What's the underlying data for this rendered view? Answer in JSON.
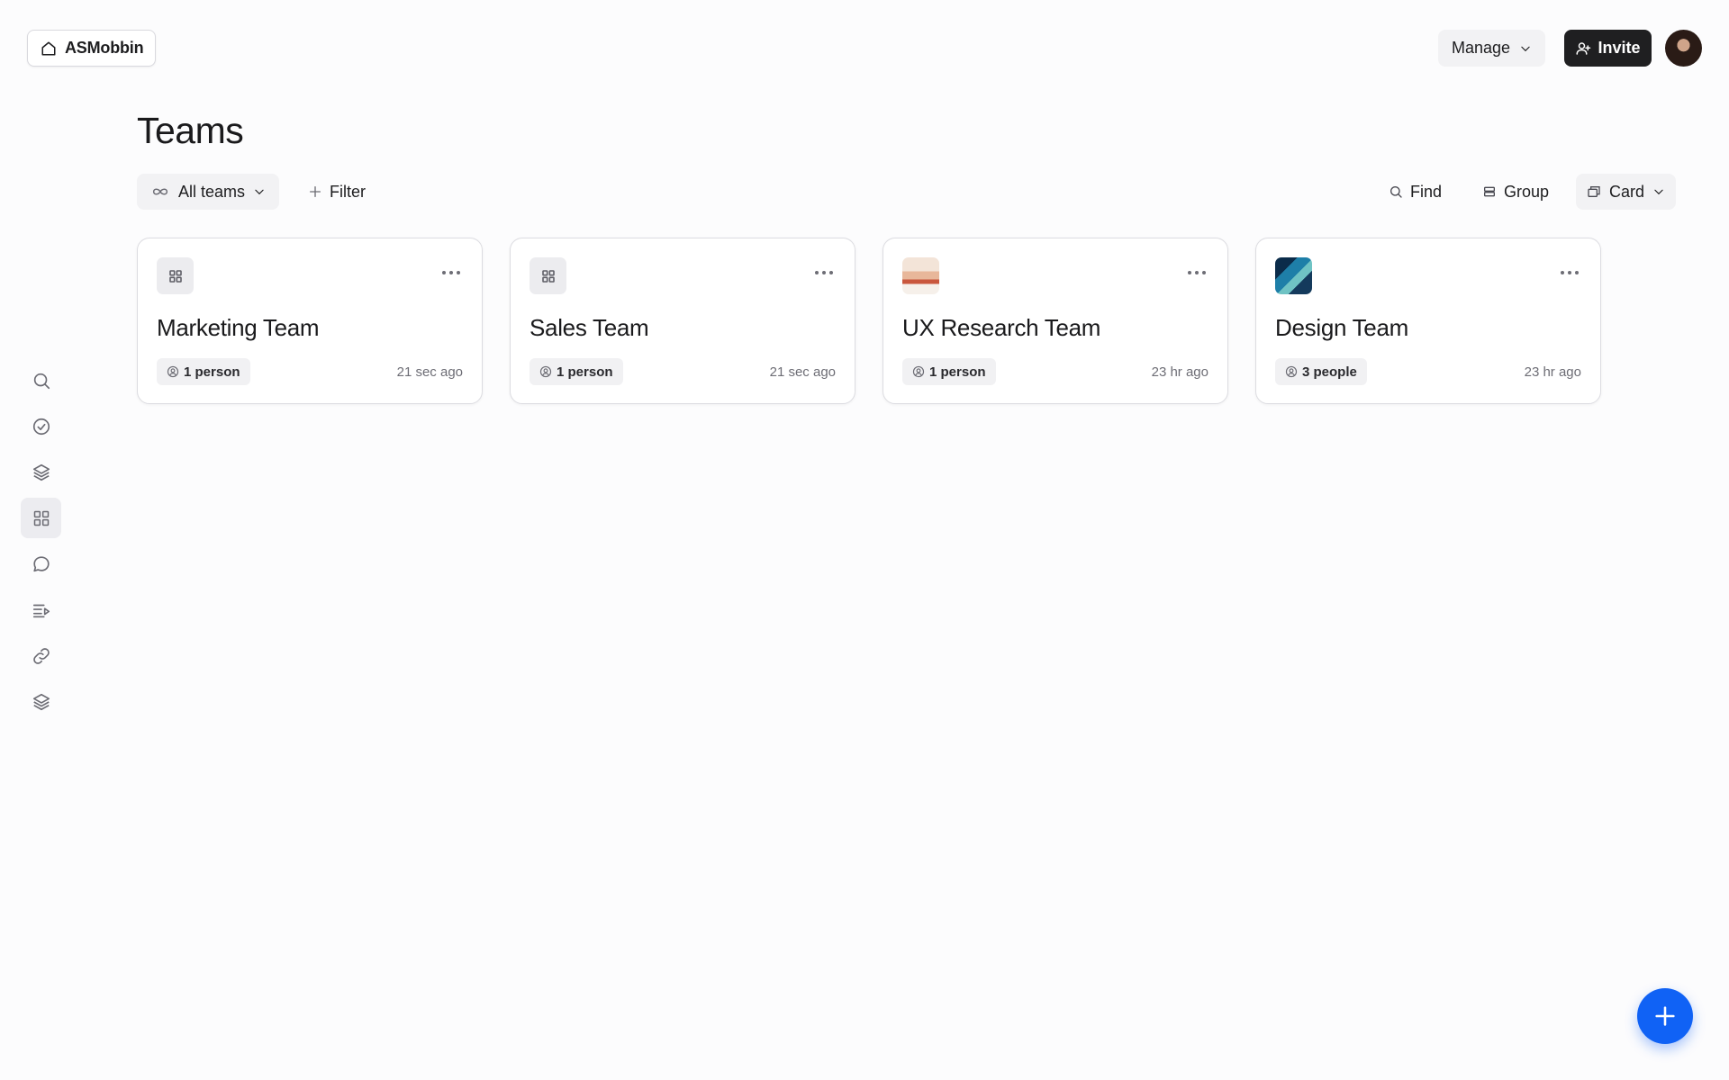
{
  "header": {
    "workspace_name": "ASMobbin",
    "manage_label": "Manage",
    "invite_label": "Invite"
  },
  "page": {
    "title": "Teams"
  },
  "toolbar": {
    "scope_label": "All teams",
    "filter_label": "Filter",
    "find_label": "Find",
    "group_label": "Group",
    "view_label": "Card"
  },
  "sidebar": {
    "items": [
      {
        "icon": "search-icon"
      },
      {
        "icon": "check-circle-icon"
      },
      {
        "icon": "layers-icon"
      },
      {
        "icon": "grid-icon",
        "active": true
      },
      {
        "icon": "chat-bubble-icon"
      },
      {
        "icon": "playlist-icon"
      },
      {
        "icon": "link-icon"
      },
      {
        "icon": "stack-icon"
      }
    ]
  },
  "teams": [
    {
      "name": "Marketing Team",
      "members": "1 person",
      "updated": "21 sec ago",
      "thumb": "generic"
    },
    {
      "name": "Sales Team",
      "members": "1 person",
      "updated": "21 sec ago",
      "thumb": "generic"
    },
    {
      "name": "UX Research Team",
      "members": "1 person",
      "updated": "23 hr ago",
      "thumb": "photo"
    },
    {
      "name": "Design Team",
      "members": "3 people",
      "updated": "23 hr ago",
      "thumb": "photo"
    }
  ],
  "colors": {
    "primary_button": "#1f1f21",
    "fab": "#1062f5",
    "background": "#fcfcfd"
  }
}
